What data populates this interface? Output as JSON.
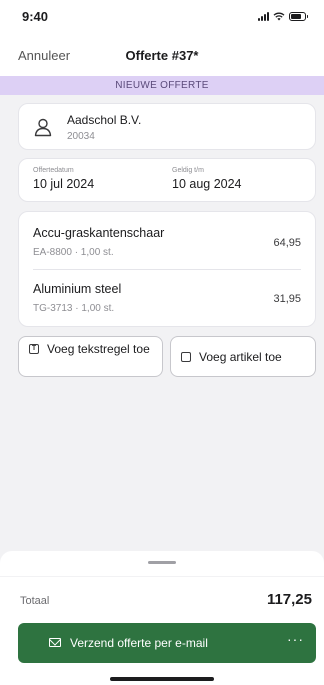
{
  "status_bar": {
    "time": "9:40"
  },
  "nav": {
    "cancel_label": "Annuleer",
    "title": "Offerte #37*"
  },
  "banner": {
    "label": "NIEUWE OFFERTE"
  },
  "customer": {
    "icon": "person-icon",
    "name": "Aadschol B.V.",
    "number": "20034"
  },
  "dates": {
    "offer_date_label": "Offertedatum",
    "offer_date_value": "10 jul 2024",
    "valid_until_label": "Geldig t/m",
    "valid_until_value": "10 aug 2024"
  },
  "items": [
    {
      "name": "Accu-graskantenschaar",
      "meta": "EA-8800 · 1,00 st.",
      "price": "64,95"
    },
    {
      "name": "Aluminium steel",
      "meta": "TG-3713 · 1,00 st.",
      "price": "31,95"
    }
  ],
  "actions": {
    "add_text_line_label": "Voeg tekstregel toe",
    "add_text_line_icon": "text-box-icon",
    "add_article_label": "Voeg artikel toe",
    "add_article_icon": "square-icon"
  },
  "footer": {
    "total_label": "Totaal",
    "total_value": "117,25",
    "send_label": "Verzend offerte per e-mail",
    "send_icon": "mail-icon",
    "more_label": "···"
  },
  "colors": {
    "banner_bg": "#ddd0f5",
    "primary_button": "#2e7340",
    "background": "#f2f2f4"
  }
}
